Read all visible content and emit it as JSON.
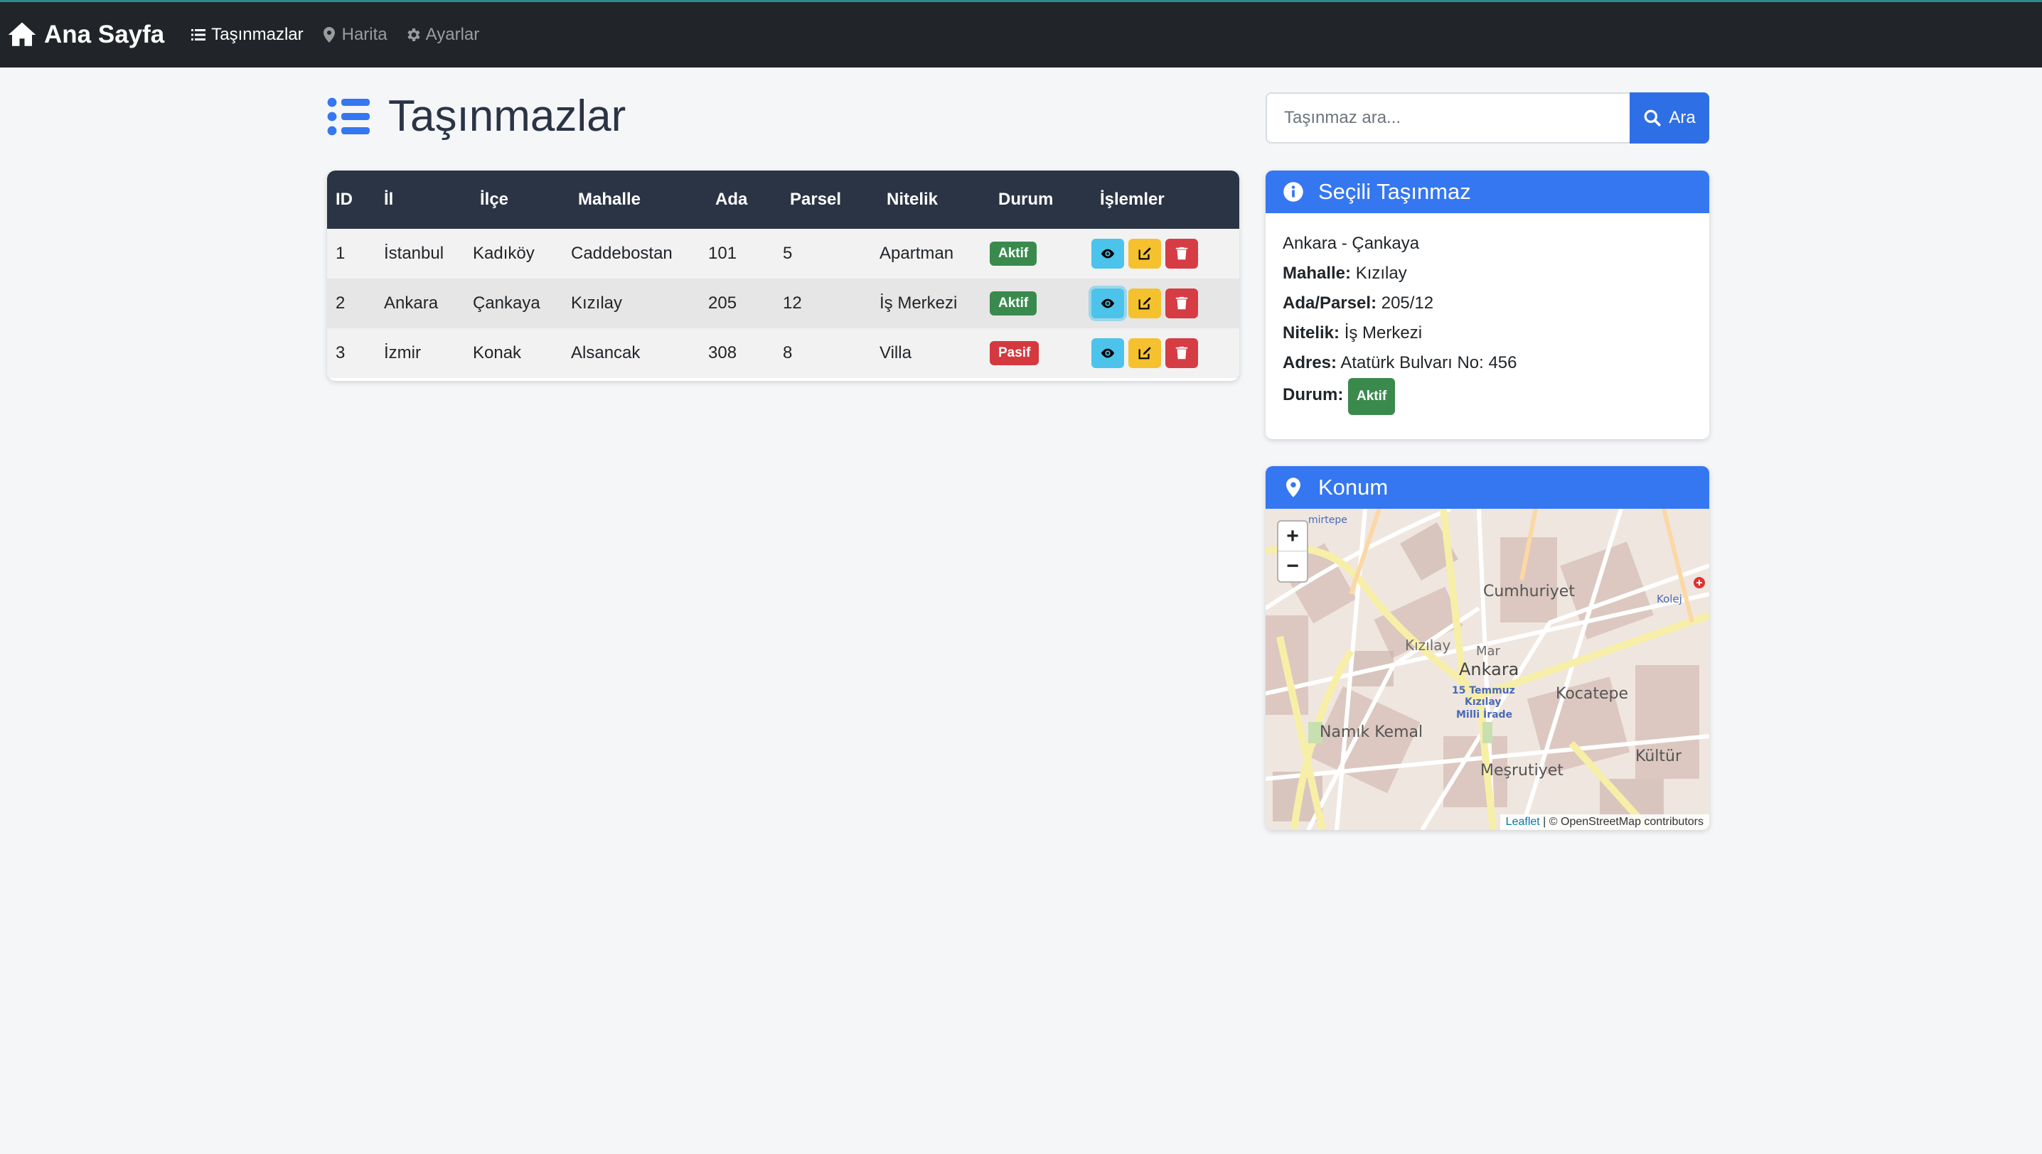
{
  "navbar": {
    "brand": "Ana Sayfa",
    "links": [
      {
        "label": "Taşınmazlar",
        "icon": "list-icon",
        "active": true
      },
      {
        "label": "Harita",
        "icon": "map-marker-icon",
        "active": false
      },
      {
        "label": "Ayarlar",
        "icon": "gear-icon",
        "active": false
      }
    ]
  },
  "page": {
    "title": "Taşınmazlar"
  },
  "table": {
    "headers": [
      "ID",
      "İl",
      "İlçe",
      "Mahalle",
      "Ada",
      "Parsel",
      "Nitelik",
      "Durum",
      "İşlemler"
    ],
    "rows": [
      {
        "id": "1",
        "il": "İstanbul",
        "ilce": "Kadıköy",
        "mahalle": "Caddebostan",
        "ada": "101",
        "parsel": "5",
        "nitelik": "Apartman",
        "durum": "Aktif"
      },
      {
        "id": "2",
        "il": "Ankara",
        "ilce": "Çankaya",
        "mahalle": "Kızılay",
        "ada": "205",
        "parsel": "12",
        "nitelik": "İş Merkezi",
        "durum": "Aktif"
      },
      {
        "id": "3",
        "il": "İzmir",
        "ilce": "Konak",
        "mahalle": "Alsancak",
        "ada": "308",
        "parsel": "8",
        "nitelik": "Villa",
        "durum": "Pasif"
      }
    ]
  },
  "search": {
    "placeholder": "Taşınmaz ara...",
    "button": "Ara"
  },
  "detail": {
    "title": "Seçili Taşınmaz",
    "location": "Ankara - Çankaya",
    "mahalle_label": "Mahalle:",
    "mahalle": "Kızılay",
    "adaparsel_label": "Ada/Parsel:",
    "adaparsel": "205/12",
    "nitelik_label": "Nitelik:",
    "nitelik": "İş Merkezi",
    "adres_label": "Adres:",
    "adres": "Atatürk Bulvarı No: 456",
    "durum_label": "Durum:",
    "durum": "Aktif"
  },
  "map": {
    "title": "Konum",
    "zoom_in": "+",
    "zoom_out": "−",
    "attribution_leaflet": "Leaflet",
    "attribution_rest": "| © OpenStreetMap contributors",
    "labels": {
      "cumhuriyet": "Cumhuriyet",
      "kizilay": "Kızılay",
      "ankara": "Ankara",
      "mar": "Mar",
      "kocatepe": "Kocatepe",
      "namik_kemal": "Namık Kemal",
      "mesrutiyet": "Meşrutiyet",
      "kultur": "Kültür",
      "kolej": "Kolej",
      "temmuz": "15 Temmuz",
      "kizilay_small": "Kızılay",
      "milli_irade": "Milli İrade",
      "emirtepe": "mirtepe"
    }
  },
  "colors": {
    "navbar": "#212529",
    "primary": "#3577f0",
    "success": "#3a8a4e",
    "danger": "#d4393f",
    "info": "#4cc3ea",
    "warning": "#f6c12e"
  }
}
